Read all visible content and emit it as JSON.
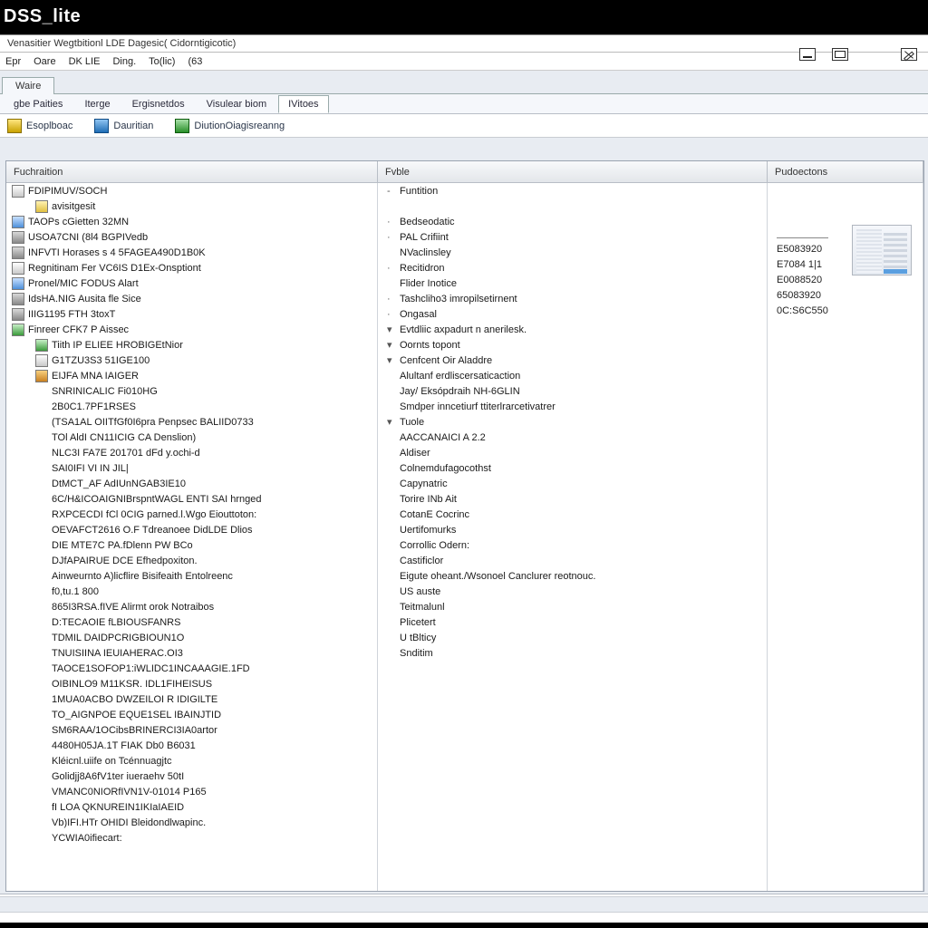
{
  "title": "DSS_lite",
  "subtitle": "Venasitier Wegtbitionl LDE Dagesic( Cidorntigicotic)",
  "menu": [
    "Epr",
    "Oare",
    "DK LIE",
    "Ding.",
    "To(lic)",
    "(63"
  ],
  "main_tab": "Waire",
  "section_tabs": [
    "gbe Paities",
    "Iterge",
    "Ergisnetdos",
    "Visulear biom",
    "IVitoes"
  ],
  "toolbar": [
    {
      "icon": "ic-yel",
      "label": "Esoplboac"
    },
    {
      "icon": "ic-blu",
      "label": "Dauritian"
    },
    {
      "icon": "ic-grn",
      "label": "DiutionOiagisreanng"
    }
  ],
  "columns": {
    "c1": "Fuchraition",
    "c2": "Fvble",
    "c3": "Pudoectons"
  },
  "tree": [
    {
      "ico": "ic-d",
      "txt": "FDIPIMUV/SOCH"
    },
    {
      "ico": "ic-a",
      "txt": "avisitgesit",
      "indent": 1
    },
    {
      "ico": "ic-b",
      "txt": "TAOPs cGietten 32MN"
    },
    {
      "ico": "ic-c",
      "txt": "USOA7CNI (8l4 BGPIVedb"
    },
    {
      "ico": "ic-c",
      "txt": "INFVTI Horases s 4 5FAGEA490D1B0K"
    },
    {
      "ico": "ic-d",
      "txt": "Regnitinam Fer VC6IS D1Ex-Onsptiont"
    },
    {
      "ico": "ic-b",
      "txt": "Pronel/MIC FODUS Alart"
    },
    {
      "ico": "ic-c",
      "txt": "IdsHA.NIG Ausita fle Sice"
    },
    {
      "ico": "ic-c",
      "txt": "IIIG1195 FTH 3toxT"
    },
    {
      "ico": "ic-e",
      "txt": "Finreer CFK7 P Aissec"
    },
    {
      "ico": "ic-e",
      "txt": "Tiith IP ELIEE HROBIGEtNior",
      "indent": 1
    },
    {
      "ico": "ic-d",
      "txt": "G1TZU3S3 51IGE100",
      "indent": 1
    },
    {
      "ico": "ic-f",
      "txt": "EIJFA MNA IAIGER",
      "indent": 1
    },
    {
      "txt": "SNRINICALIC Fi010HG",
      "indent": 2
    },
    {
      "txt": "2B0C1.7PF1RSES",
      "indent": 2
    },
    {
      "txt": "(TSA1AL OIITfGf0I6pra Penpsec BALIID0733",
      "indent": 2
    },
    {
      "txt": "TOl AldI CN11ICIG CA Denslion)",
      "indent": 2
    },
    {
      "txt": "NLC3I FA7E 201701 dFd y.ochi-d",
      "indent": 2
    },
    {
      "txt": "SAI0IFI VI IN JIL|",
      "indent": 2
    },
    {
      "txt": "DtMCT_AF AdIUnNGAB3IE10",
      "indent": 2
    },
    {
      "txt": "6C/H&ICOAIGNIBrspntWAGL ENTI SAI hrnged",
      "indent": 2
    },
    {
      "txt": "RXPCECDI fCl 0CIG parned.l.Wgo Eiouttoton:",
      "indent": 2
    },
    {
      "txt": "OEVAFCT2616 O.F Tdreanoee DidLDE Dlios",
      "indent": 2
    },
    {
      "txt": "DIE MTE7C PA.fDlenn PW BCo",
      "indent": 2
    },
    {
      "txt": "DJfAPAIRUE DCE Efhedpoxiton.",
      "indent": 2
    },
    {
      "txt": "Ainweurnto A)licflire Bisifeaith Entolreenc",
      "indent": 2
    },
    {
      "txt": "f0,tu.1 800",
      "indent": 2
    },
    {
      "txt": "865I3RSA.fIVE Alirmt orok Notraibos",
      "indent": 2
    },
    {
      "txt": "D:TECAOIE fLBIOUSFANRS",
      "indent": 2
    },
    {
      "txt": "TDMIL DAIDPCRIGBIOUN1O",
      "indent": 2
    },
    {
      "txt": "TNUISIINA IEUIAHERAC.OI3",
      "indent": 2
    },
    {
      "txt": "TAOCE1SOFOP1:iWLIDC1INCAAAGIE.1FD",
      "indent": 2
    },
    {
      "txt": "OIBINLO9 M11KSR. IDL1FIHEISUS",
      "indent": 2
    },
    {
      "txt": "1MUA0ACBO DWZEILOI R IDIGILTE",
      "indent": 2
    },
    {
      "txt": "TO_AIGNPOE EQUE1SEL IBAINJTID",
      "indent": 2
    },
    {
      "txt": "SM6RAA/1OCibsBRINERCI3IA0artor",
      "indent": 2
    },
    {
      "txt": "4480H05JA.1T FIAK Db0 B6031",
      "indent": 2
    },
    {
      "txt": "Kléicnl.uiife on Tcénnuagjtc",
      "indent": 2
    },
    {
      "txt": "Golidjj8A6fV1ter iueraehv 50tI",
      "indent": 2
    },
    {
      "txt": "VMANC0NIORfIVN1V-01014 P165",
      "indent": 2
    },
    {
      "txt": "fI LOA QKNUREIN1IKIaIAEID",
      "indent": 2
    },
    {
      "txt": "Vb)IFI.HTr OHIDI Bleidondlwapinc.",
      "indent": 2
    },
    {
      "txt": "YCWIA0ifiecart:",
      "indent": 2
    }
  ],
  "functions": [
    {
      "caret": "-",
      "txt": "Funtition"
    },
    {
      "caret": "",
      "txt": ""
    },
    {
      "caret": "·",
      "txt": "Bedseodatic"
    },
    {
      "caret": "·",
      "txt": "PAL Crifiint"
    },
    {
      "caret": "",
      "txt": "NVaclinsley"
    },
    {
      "caret": "·",
      "txt": "Recitidron"
    },
    {
      "caret": "",
      "txt": "Flider Inotice"
    },
    {
      "caret": "·",
      "txt": "Tashcliho3 imropilsetirnent"
    },
    {
      "caret": "·",
      "txt": "Ongasal"
    },
    {
      "caret": "▾",
      "txt": "Evtdliic axpadurt n anerilesk."
    },
    {
      "caret": "▾",
      "txt": "Oornts topont"
    },
    {
      "caret": "▾",
      "txt": "Cenfcent Oir Aladdre"
    },
    {
      "caret": "",
      "txt": "Alultanf erdliscersaticaction"
    },
    {
      "caret": "",
      "txt": "Jay/ Eksópdraih NH-6GLIN"
    },
    {
      "caret": "",
      "txt": "Smdper inncetiurf ttiterlrarcetivatrer"
    },
    {
      "caret": "▾",
      "txt": "Tuole"
    },
    {
      "caret": "",
      "txt": "AACCANAICI A 2.2"
    },
    {
      "caret": "",
      "txt": "Aldiser"
    },
    {
      "caret": "",
      "txt": "Colnemdufagocothst"
    },
    {
      "caret": "",
      "txt": "Capynatric"
    },
    {
      "caret": "",
      "txt": "Torire INb Ait"
    },
    {
      "caret": "",
      "txt": "CotanE Cocrinc"
    },
    {
      "caret": "",
      "txt": "Uertifomurks"
    },
    {
      "caret": "",
      "txt": "Corrollic Odern:"
    },
    {
      "caret": "",
      "txt": "Castificlor"
    },
    {
      "caret": "",
      "txt": "Eigute oheant./Wsonoel Canclurer reotnouc."
    },
    {
      "caret": "",
      "txt": "US auste"
    },
    {
      "caret": "",
      "txt": "Teitmalunl"
    },
    {
      "caret": "",
      "txt": "Plicetert"
    },
    {
      "caret": "",
      "txt": "U tBlticy"
    },
    {
      "caret": "",
      "txt": "Snditim"
    }
  ],
  "codes": [
    "E5083920",
    "E7084 1|1",
    "E0088520",
    "65083920",
    "0C:S6C550"
  ]
}
